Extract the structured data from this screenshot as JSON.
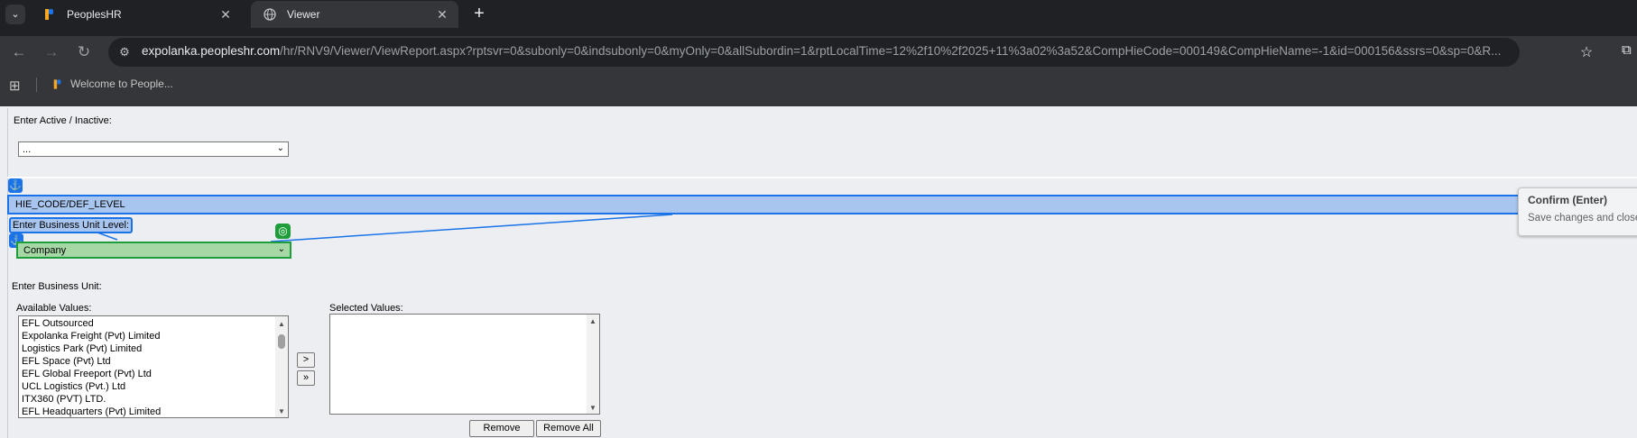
{
  "browser": {
    "tabs": [
      {
        "title": "PeoplesHR",
        "active": false,
        "icon": "peopleshr-logo-icon"
      },
      {
        "title": "Viewer",
        "active": true,
        "icon": "globe-icon"
      }
    ],
    "url_host": "expolanka.peopleshr.com",
    "url_path": "/hr/RNV9/Viewer/ViewReport.aspx?rptsvr=0&subonly=0&indsubonly=0&myOnly=0&allSubordin=1&rptLocalTime=12%2f10%2f2025+11%3a02%3a52&CompHieCode=000149&CompHieName=-1&id=000156&ssrs=0&sp=0&R...",
    "bookmark": "Welcome to People..."
  },
  "form": {
    "active_inactive_label": "Enter Active / Inactive:",
    "active_inactive_value": "...",
    "hie_code_label": "HIE_CODE/DEF_LEVEL",
    "business_unit_level_label": "Enter Business Unit Level:",
    "business_unit_level_value": "Company",
    "business_unit_label": "Enter Business Unit:",
    "available_values_label": "Available Values:",
    "selected_values_label": "Selected Values:",
    "available_values": [
      "EFL Outsourced",
      "Expolanka Freight (Pvt) Limited",
      "Logistics Park (Pvt) Limited",
      "EFL Space (Pvt) Ltd",
      "EFL Global Freeport (Pvt) Ltd",
      "UCL Logistics (Pvt.) Ltd",
      "ITX360 (PVT) LTD.",
      "EFL Headquarters (Pvt) Limited"
    ],
    "move_one_label": ">",
    "move_all_label": "»",
    "remove_label": "Remove",
    "remove_all_label": "Remove All"
  },
  "tooltip": {
    "title": "Confirm (Enter)",
    "subtitle": "Save changes and close"
  },
  "colors": {
    "highlight_blue": "#1a73e8",
    "highlight_green": "#1e9e3a"
  }
}
